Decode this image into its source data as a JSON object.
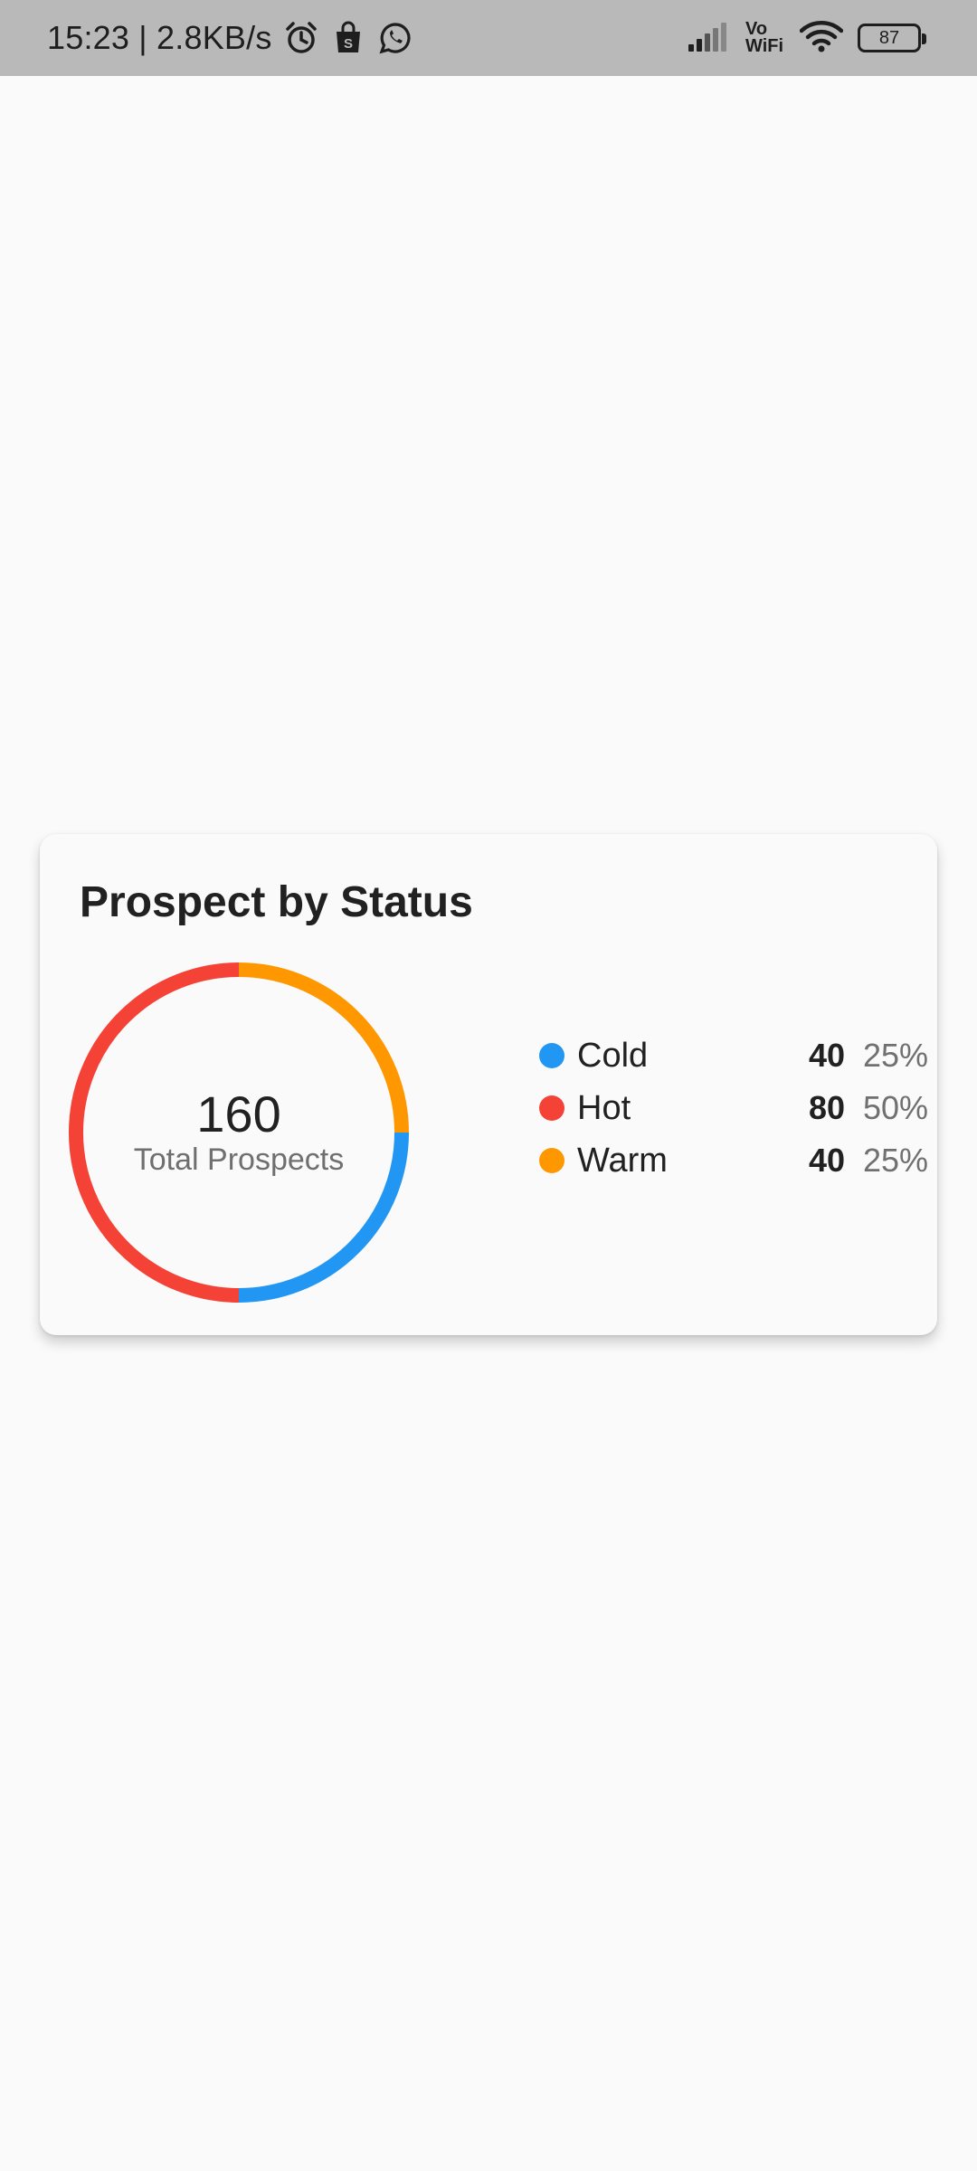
{
  "status_bar": {
    "time_speed": "15:23 | 2.8KB/s",
    "icons": [
      "alarm-icon",
      "shopping-bag-icon",
      "whatsapp-icon",
      "signal-icon",
      "vowifi-icon",
      "wifi-icon",
      "battery-icon"
    ],
    "vowifi_top": "Vo",
    "vowifi_bottom": "WiFi",
    "battery_level": "87"
  },
  "card": {
    "title": "Prospect by Status",
    "total_value": "160",
    "total_label": "Total Prospects"
  },
  "chart_data": {
    "type": "pie",
    "title": "Prospect by Status",
    "center_value": 160,
    "center_label": "Total Prospects",
    "categories": [
      "Cold",
      "Hot",
      "Warm"
    ],
    "values": [
      40,
      80,
      40
    ],
    "percents": [
      "25%",
      "50%",
      "25%"
    ],
    "colors": [
      "#2196F3",
      "#F44336",
      "#FF9800"
    ]
  },
  "legend": [
    {
      "label": "Cold",
      "count": "40",
      "percent": "25%",
      "color": "#2196F3"
    },
    {
      "label": "Hot",
      "count": "80",
      "percent": "50%",
      "color": "#F44336"
    },
    {
      "label": "Warm",
      "count": "40",
      "percent": "25%",
      "color": "#FF9800"
    }
  ]
}
